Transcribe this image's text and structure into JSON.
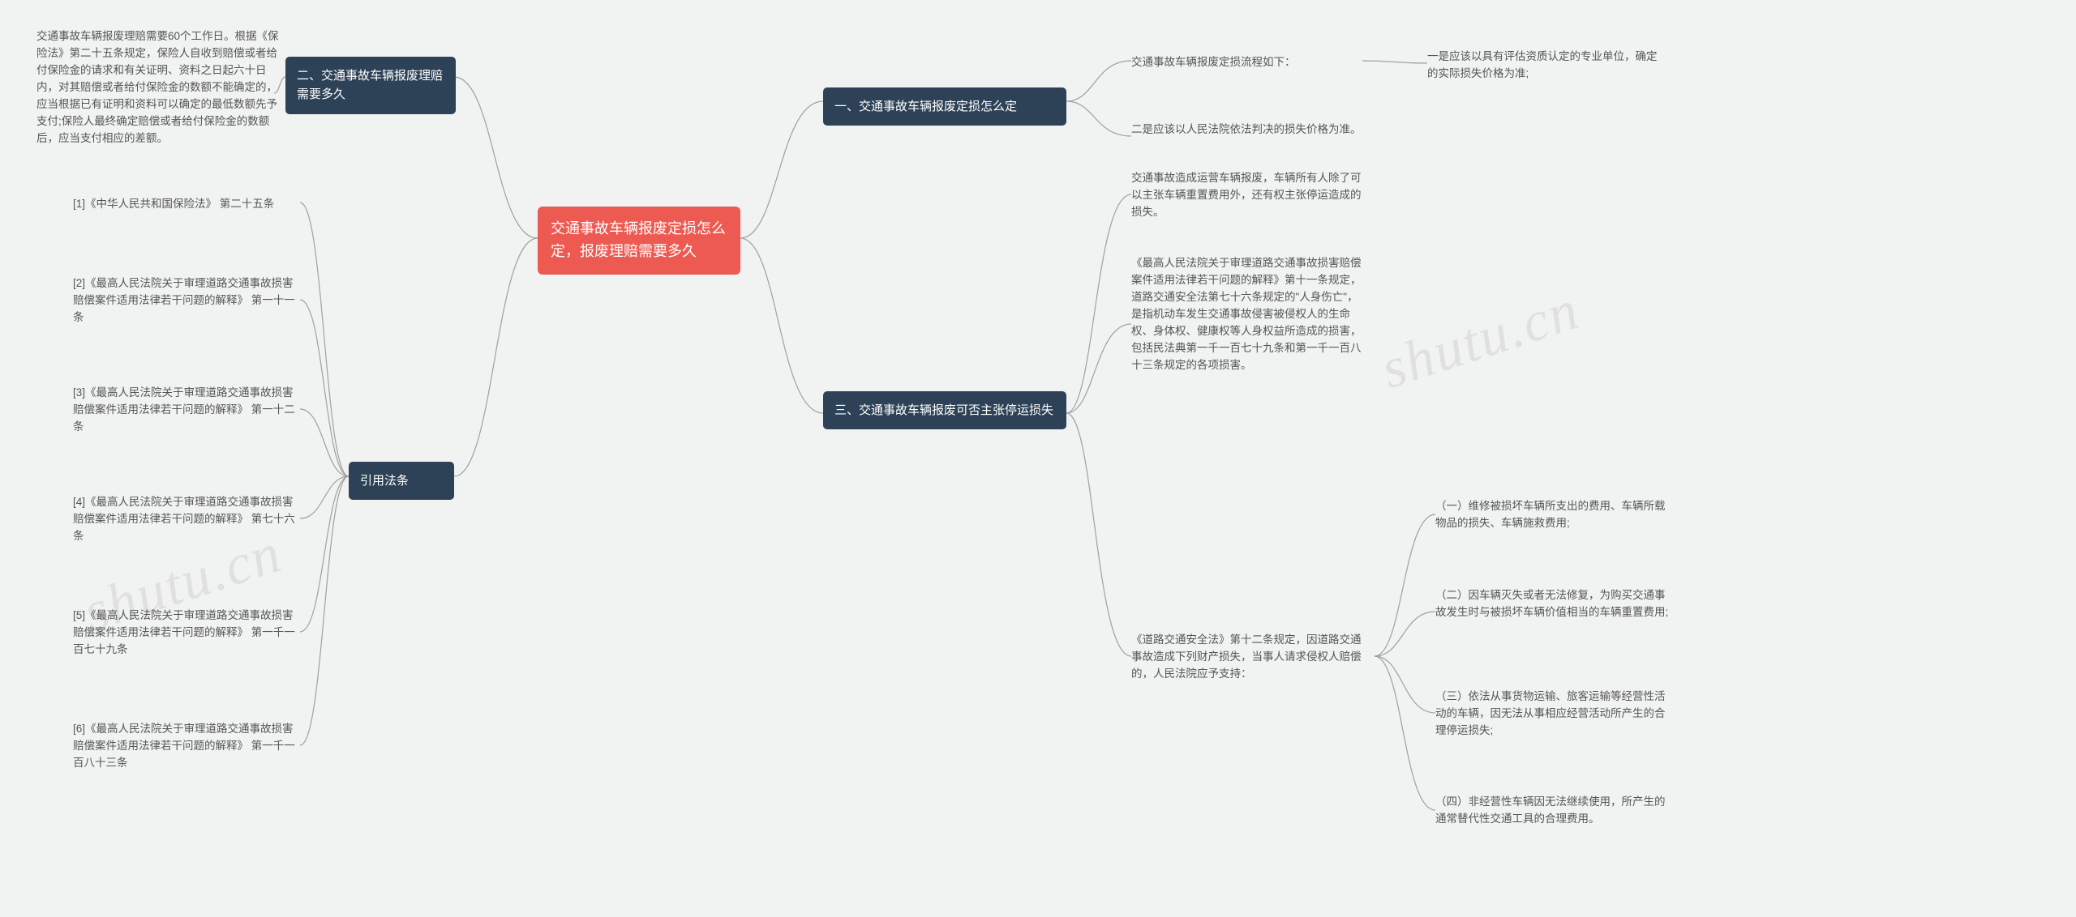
{
  "watermark": "shutu.cn",
  "root": {
    "title": "交通事故车辆报废定损怎么定，报废理赔需要多久"
  },
  "right": {
    "section1": {
      "title": "一、交通事故车辆报废定损怎么定",
      "intro": "交通事故车辆报废定损流程如下：",
      "item1": "一是应该以具有评估资质认定的专业单位，确定的实际损失价格为准;",
      "item2": "二是应该以人民法院依法判决的损失价格为准。"
    },
    "section3": {
      "title": "三、交通事故车辆报废可否主张停运损失",
      "p1": "交通事故造成运营车辆报废，车辆所有人除了可以主张车辆重置费用外，还有权主张停运造成的损失。",
      "p2": "《最高人民法院关于审理道路交通事故损害赔偿案件适用法律若干问题的解释》第十一条规定，道路交通安全法第七十六条规定的\"人身伤亡\"，是指机动车发生交通事故侵害被侵权人的生命权、身体权、健康权等人身权益所造成的损害，包括民法典第一千一百七十九条和第一千一百八十三条规定的各项损害。",
      "p3": "《道路交通安全法》第十二条规定，因道路交通事故造成下列财产损失，当事人请求侵权人赔偿的，人民法院应予支持：",
      "sub": {
        "a": "（一）维修被损坏车辆所支出的费用、车辆所载物品的损失、车辆施救费用;",
        "b": "（二）因车辆灭失或者无法修复，为购买交通事故发生时与被损坏车辆价值相当的车辆重置费用;",
        "c": "（三）依法从事货物运输、旅客运输等经营性活动的车辆，因无法从事相应经营活动所产生的合理停运损失;",
        "d": "（四）非经营性车辆因无法继续使用，所产生的通常替代性交通工具的合理费用。"
      }
    }
  },
  "left": {
    "section2": {
      "title": "二、交通事故车辆报废理赔需要多久",
      "body": "交通事故车辆报废理赔需要60个工作日。根据《保险法》第二十五条规定，保险人自收到赔偿或者给付保险金的请求和有关证明、资料之日起六十日内，对其赔偿或者给付保险金的数额不能确定的，应当根据已有证明和资料可以确定的最低数额先予支付;保险人最终确定赔偿或者给付保险金的数额后，应当支付相应的差额。"
    },
    "refs": {
      "title": "引用法条",
      "r1": "[1]《中华人民共和国保险法》 第二十五条",
      "r2": "[2]《最高人民法院关于审理道路交通事故损害赔偿案件适用法律若干问题的解释》 第一十一条",
      "r3": "[3]《最高人民法院关于审理道路交通事故损害赔偿案件适用法律若干问题的解释》 第一十二条",
      "r4": "[4]《最高人民法院关于审理道路交通事故损害赔偿案件适用法律若干问题的解释》 第七十六条",
      "r5": "[5]《最高人民法院关于审理道路交通事故损害赔偿案件适用法律若干问题的解释》 第一千一百七十九条",
      "r6": "[6]《最高人民法院关于审理道路交通事故损害赔偿案件适用法律若干问题的解释》 第一千一百八十三条"
    }
  }
}
